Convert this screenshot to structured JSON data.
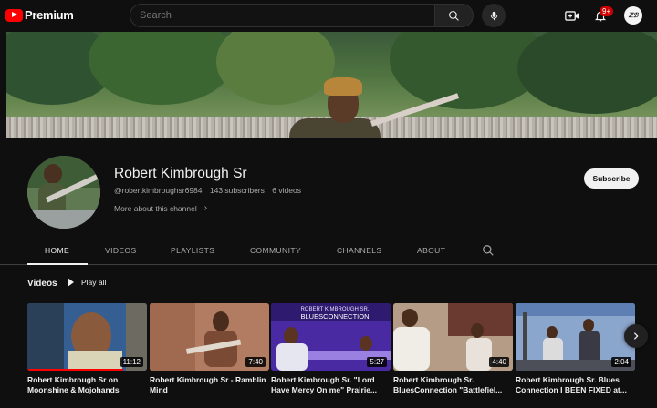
{
  "topbar": {
    "logo_text": "Premium",
    "search_placeholder": "Search",
    "notification_count": "9+",
    "avatar_text": "ℤℬ"
  },
  "channel": {
    "name": "Robert Kimbrough Sr",
    "handle": "@robertkimbroughsr6984",
    "subscribers": "143 subscribers",
    "video_count": "6 videos",
    "more_label": "More about this channel",
    "subscribe_label": "Subscribe"
  },
  "tabs": [
    {
      "label": "HOME",
      "active": true
    },
    {
      "label": "VIDEOS",
      "active": false
    },
    {
      "label": "PLAYLISTS",
      "active": false
    },
    {
      "label": "COMMUNITY",
      "active": false
    },
    {
      "label": "CHANNELS",
      "active": false
    },
    {
      "label": "ABOUT",
      "active": false
    }
  ],
  "videos_section": {
    "title": "Videos",
    "play_all_label": "Play all",
    "items": [
      {
        "title": "Robert Kimbrough Sr on Moonshine & Mojohands",
        "duration": "11:12",
        "watched_fraction": 0.8
      },
      {
        "title": "Robert Kimbrough Sr - Ramblin Mind",
        "duration": "7:40",
        "watched_fraction": 0
      },
      {
        "title": "Robert Kimbrough Sr. \"Lord Have Mercy On me\" Prairie...",
        "duration": "5:27",
        "watched_fraction": 0,
        "overlay_text_1": "ROBERT KIMBROUGH SR.",
        "overlay_text_2": "BLUESCONNECTION"
      },
      {
        "title": "Robert Kimbrough Sr. BluesConnection \"Battlefiel...",
        "duration": "4:40",
        "watched_fraction": 0
      },
      {
        "title": "Robert Kimbrough Sr. Blues Connection I BEEN FIXED at...",
        "duration": "2:04",
        "watched_fraction": 0
      }
    ]
  },
  "colors": {
    "background": "#0f0f0f",
    "brand_red": "#ff0000",
    "text_primary": "#f1f1f1",
    "text_secondary": "#aaaaaa"
  }
}
